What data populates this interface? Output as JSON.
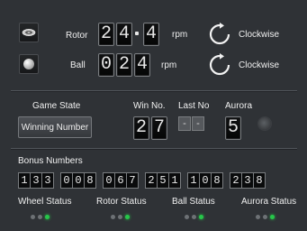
{
  "rotor": {
    "label": "Rotor",
    "digits": [
      "2",
      "4",
      "4"
    ],
    "unit": "rpm",
    "direction": "Clockwise",
    "icon": "rotor-wheel-icon"
  },
  "ball": {
    "label": "Ball",
    "digits": [
      "0",
      "2",
      "4"
    ],
    "unit": "rpm",
    "direction": "Clockwise",
    "icon": "ball-icon"
  },
  "game": {
    "state_label": "Game State",
    "state_button": "Winning Number",
    "win_label": "Win No.",
    "win_digits": [
      "2",
      "7"
    ],
    "last_label": "Last No",
    "last_digits": [
      "-",
      "-"
    ],
    "aurora_label": "Aurora",
    "aurora_value": "5"
  },
  "bonus": {
    "label": "Bonus Numbers",
    "numbers": [
      "133",
      "008",
      "067",
      "251",
      "108",
      "238"
    ]
  },
  "status": [
    {
      "label": "Wheel Status",
      "leds": [
        "off",
        "off",
        "on"
      ]
    },
    {
      "label": "Rotor Status",
      "leds": [
        "off",
        "off",
        "on"
      ]
    },
    {
      "label": "Ball Status",
      "leds": [
        "off",
        "off",
        "on"
      ]
    },
    {
      "label": "Aurora Status",
      "leds": [
        "off",
        "off",
        "on"
      ]
    }
  ],
  "colors": {
    "background": "#2f3236",
    "led_on": "#27c64a",
    "led_off": "#6d7175"
  }
}
